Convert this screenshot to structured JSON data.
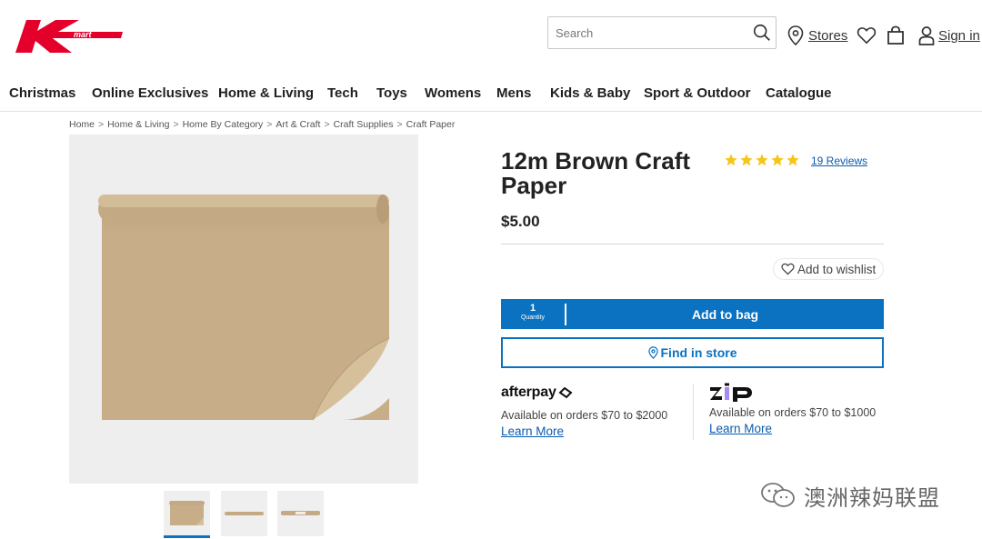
{
  "header": {
    "logo_text": "Kmart",
    "search": {
      "placeholder": "Search",
      "value": ""
    },
    "stores_label": "Stores",
    "signin_label": "Sign in"
  },
  "nav": {
    "items": [
      "Christmas",
      "Online Exclusives",
      "Home & Living",
      "Tech",
      "Toys",
      "Womens",
      "Mens",
      "Kids & Baby",
      "Sport & Outdoor",
      "Catalogue"
    ]
  },
  "breadcrumb": {
    "items": [
      "Home",
      "Home & Living",
      "Home By Category",
      "Art & Craft",
      "Craft Supplies",
      "Craft Paper"
    ],
    "separator": ">"
  },
  "product": {
    "title": "12m Brown Craft Paper",
    "rating": 5,
    "rating_max": 5,
    "reviews_label": "19 Reviews",
    "price": "$5.00",
    "wishlist_label": "Add to wishlist",
    "quantity_value": "1",
    "quantity_label": "Quantity",
    "add_to_bag_label": "Add to bag",
    "find_in_store_label": "Find in store",
    "thumbnail_count": 3,
    "active_thumbnail": 1
  },
  "payments": {
    "afterpay": {
      "brand": "afterpay",
      "availability": "Available on orders $70 to $2000",
      "learn_more": "Learn More"
    },
    "zip": {
      "brand": "zip",
      "availability": "Available on orders $70 to $1000",
      "learn_more": "Learn More"
    }
  },
  "watermark": {
    "text": "澳洲辣妈联盟"
  },
  "colors": {
    "brand_red": "#e4002b",
    "accent_blue": "#0a72c0",
    "star_yellow": "#f5c518",
    "paper_tan": "#c9b08a",
    "zip_purple": "#a58cf5"
  }
}
